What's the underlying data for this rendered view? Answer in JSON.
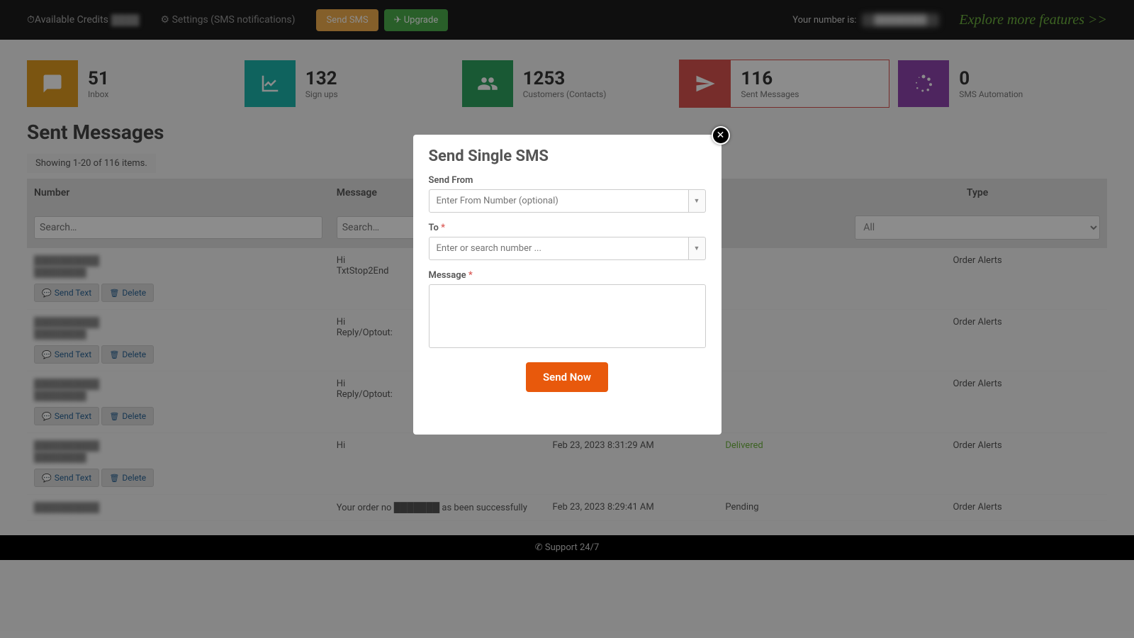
{
  "topbar": {
    "credits_label": "Available Credits",
    "credits_value": "████",
    "settings": "Settings (SMS notifications)",
    "send_sms": "Send SMS",
    "upgrade": "Upgrade",
    "your_number_label": "Your number is:",
    "your_number_value": "████████",
    "explore": "Explore more features >>"
  },
  "stats": {
    "inbox": {
      "num": "51",
      "lbl": "Inbox"
    },
    "signups": {
      "num": "132",
      "lbl": "Sign ups"
    },
    "customers": {
      "num": "1253",
      "lbl": "Customers (Contacts)"
    },
    "sent": {
      "num": "116",
      "lbl": "Sent Messages"
    },
    "automation": {
      "num": "0",
      "lbl": "SMS Automation"
    }
  },
  "page": {
    "title": "Sent Messages",
    "showing": "Showing 1-20 of 116 items."
  },
  "table": {
    "headers": {
      "number": "Number",
      "message": "Message",
      "date": "",
      "status": "",
      "type": "Type"
    },
    "search_placeholder": "Search…",
    "type_filter": "All",
    "actions": {
      "send_text": "Send Text",
      "delete": "Delete"
    },
    "rows": [
      {
        "number": "██████████",
        "name": "████████",
        "message": "Hi\nTxtStop2End",
        "date": "",
        "status": "",
        "type": "Order Alerts"
      },
      {
        "number": "██████████",
        "name": "████████",
        "message": "Hi\nReply/Optout:",
        "date": "",
        "status": "",
        "type": "Order Alerts"
      },
      {
        "number": "██████████",
        "name": "████████",
        "message": "Hi\nReply/Optout:",
        "date": "",
        "status": "",
        "type": "Order Alerts"
      },
      {
        "number": "██████████",
        "name": "████████",
        "message": "Hi",
        "date": "Feb 23, 2023 8:31:29 AM",
        "status": "Delivered",
        "type": "Order Alerts"
      },
      {
        "number": "██████████",
        "name": "",
        "message": "Your order no ███████ as been successfully",
        "date": "Feb 23, 2023 8:29:41 AM",
        "status": "Pending",
        "type": "Order Alerts"
      }
    ]
  },
  "footer": {
    "support": "Support 24/7"
  },
  "modal": {
    "title": "Send Single SMS",
    "send_from_label": "Send From",
    "send_from_placeholder": "Enter From Number (optional)",
    "to_label": "To",
    "to_placeholder": "Enter or search number ...",
    "message_label": "Message",
    "send_now": "Send Now"
  }
}
